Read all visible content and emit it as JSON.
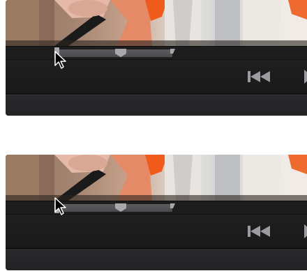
{
  "panels": [
    {
      "id": "frame-1",
      "step": "before-drag"
    },
    {
      "id": "frame-2",
      "step": "after-drag"
    }
  ],
  "player": {
    "scrubber": {
      "trim_start_position": 0.15,
      "playhead_position": 0.38,
      "trim_end_position": 0.55
    },
    "controls": {
      "rewind_icon": "skip-to-start-icon",
      "play_icon": "play-icon"
    },
    "cursor_icon": "mouse-pointer-icon"
  },
  "colors": {
    "panel_background": "#1c1c1d",
    "scrubber_range": "#535356",
    "handle": "#a9a9ad",
    "control_icon": "#9c9ca0"
  }
}
